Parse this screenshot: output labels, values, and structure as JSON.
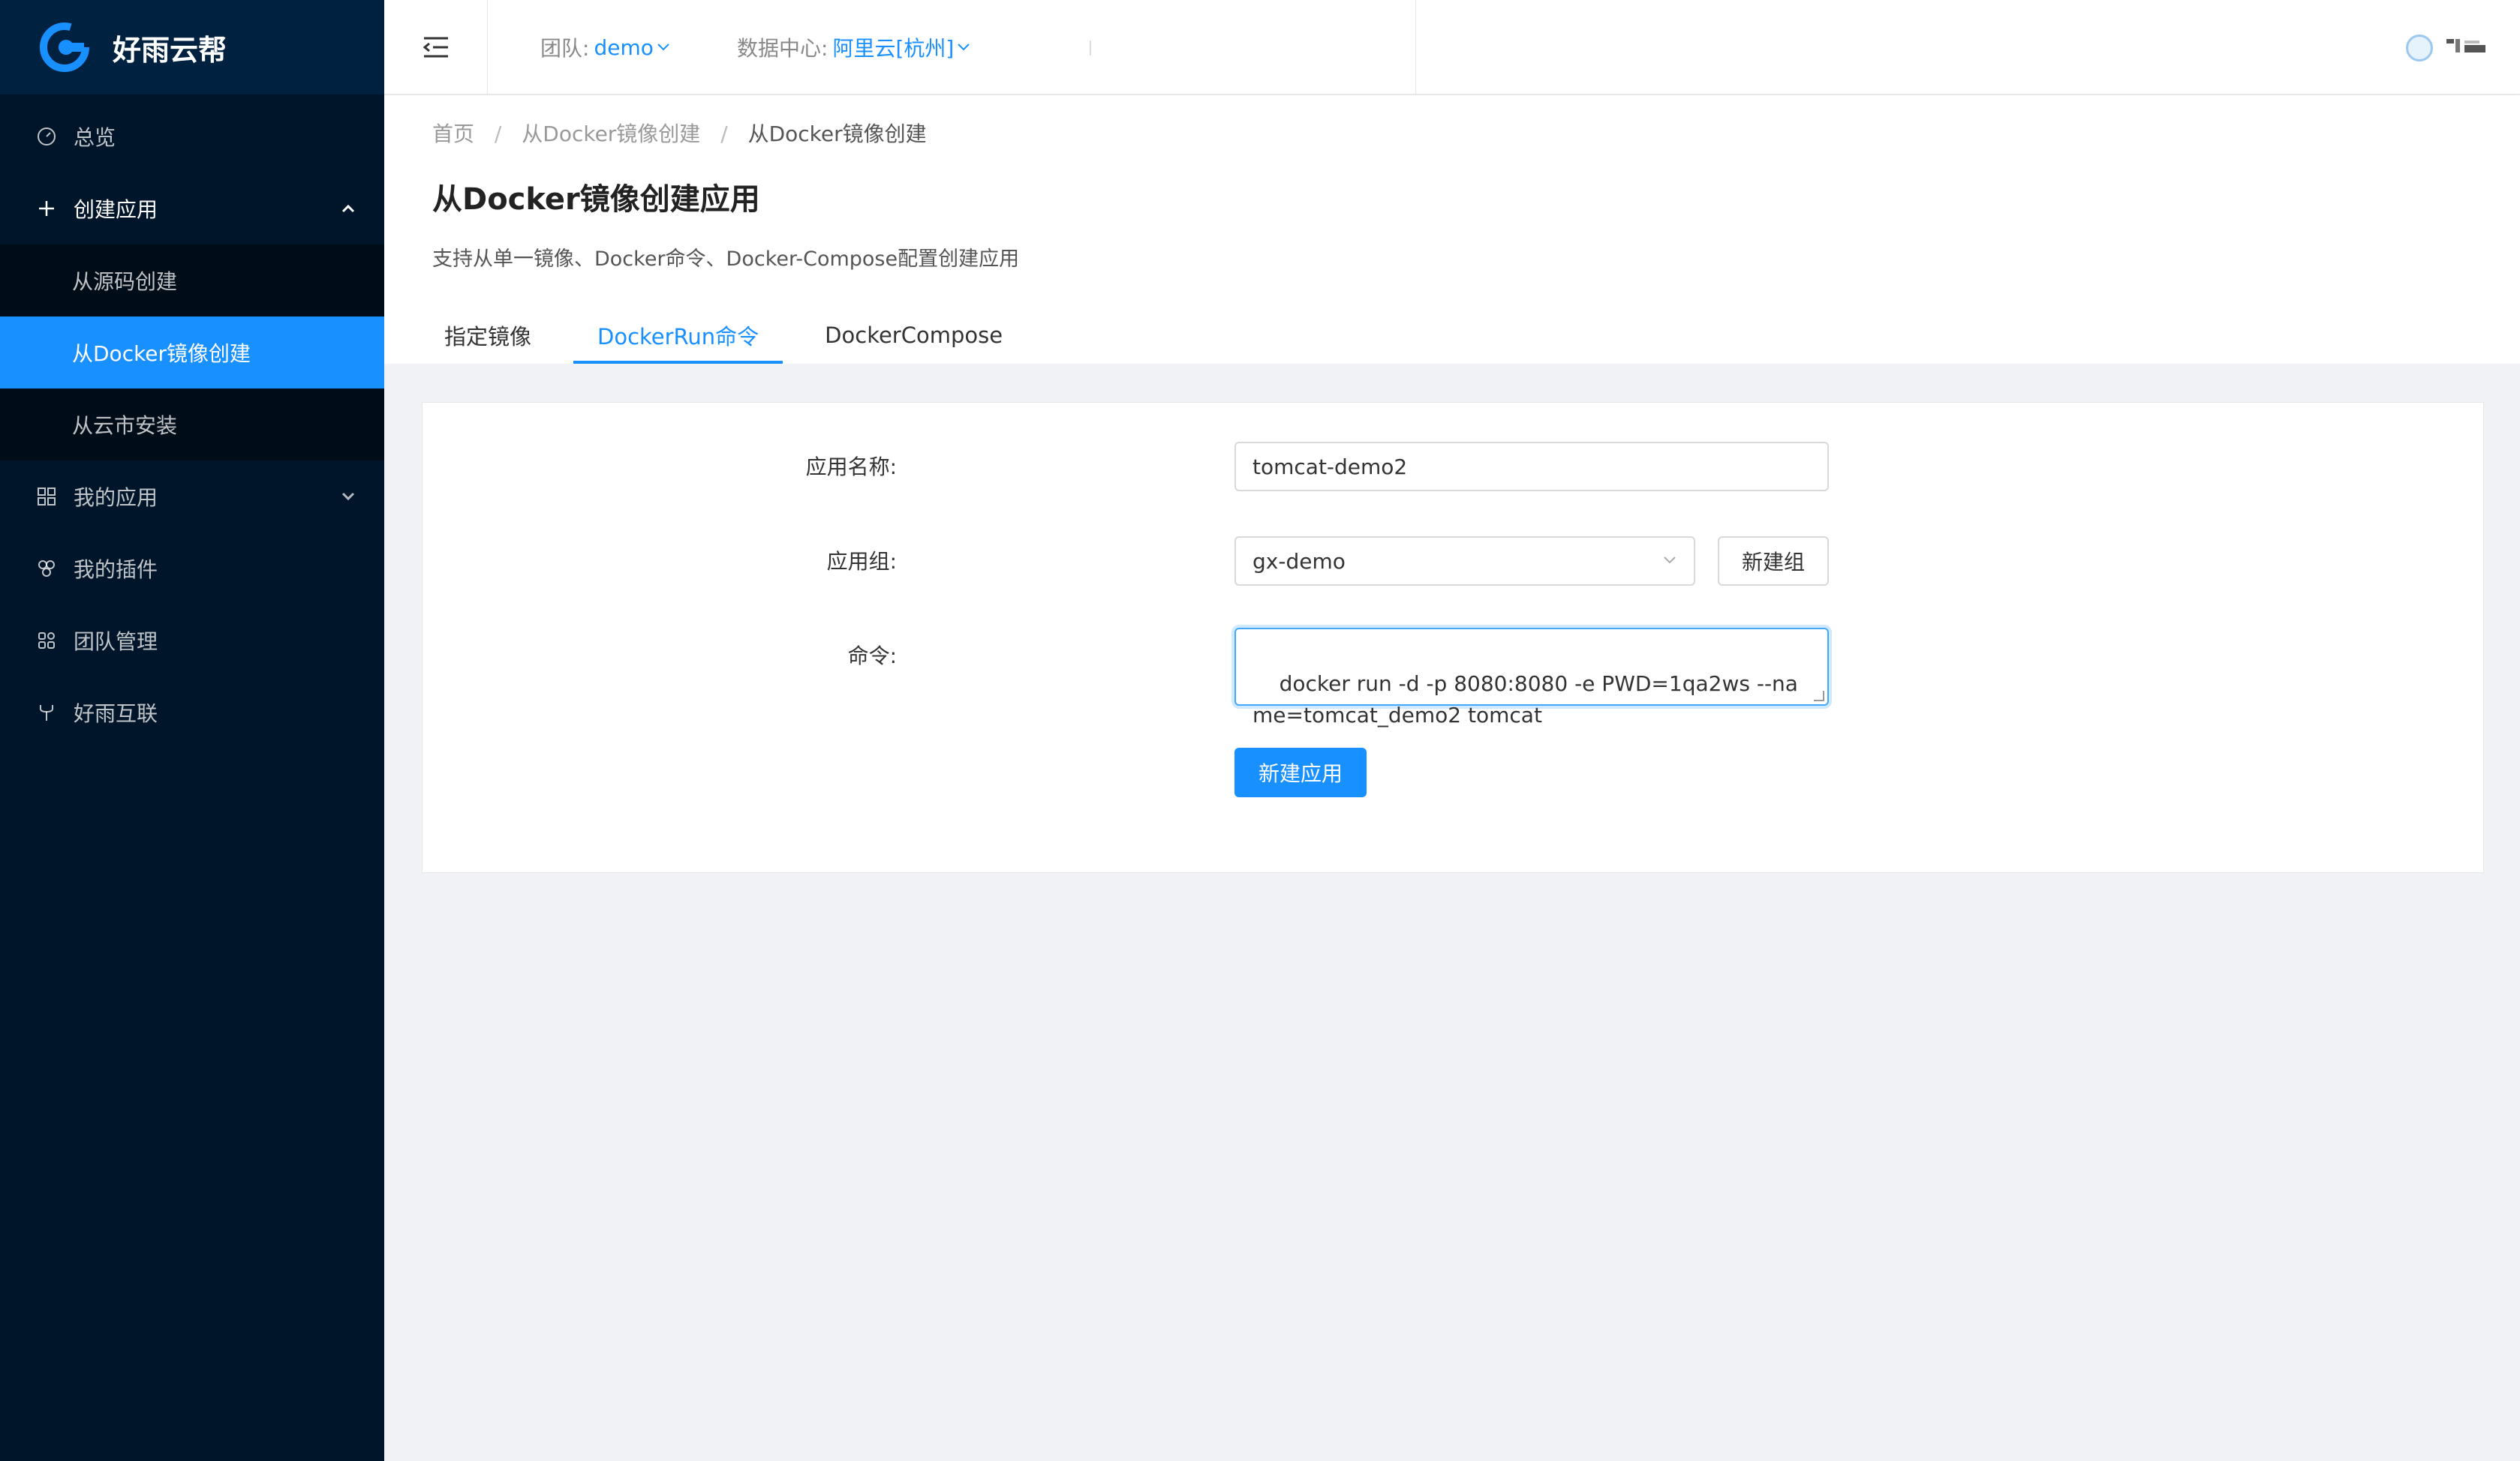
{
  "brand": {
    "name": "好雨云帮"
  },
  "sidebar": {
    "items": [
      {
        "label": "总览",
        "icon": "dashboard-icon"
      },
      {
        "label": "创建应用",
        "icon": "plus-icon",
        "open": true,
        "children": [
          {
            "label": "从源码创建"
          },
          {
            "label": "从Docker镜像创建",
            "selected": true
          },
          {
            "label": "从云市安装"
          }
        ]
      },
      {
        "label": "我的应用",
        "icon": "appstore-icon"
      },
      {
        "label": "我的插件",
        "icon": "plugin-icon"
      },
      {
        "label": "团队管理",
        "icon": "team-icon"
      },
      {
        "label": "好雨互联",
        "icon": "fork-icon"
      }
    ]
  },
  "header": {
    "team_label": "团队:",
    "team_value": "demo",
    "region_label": "数据中心:",
    "region_value": "阿里云[杭州]"
  },
  "breadcrumb": [
    "首页",
    "从Docker镜像创建",
    "从Docker镜像创建"
  ],
  "page": {
    "title": "从Docker镜像创建应用",
    "description": "支持从单一镜像、Docker命令、Docker-Compose配置创建应用"
  },
  "tabs": [
    {
      "label": "指定镜像"
    },
    {
      "label": "DockerRun命令",
      "active": true
    },
    {
      "label": "DockerCompose"
    }
  ],
  "form": {
    "app_name_label": "应用名称:",
    "app_name_value": "tomcat-demo2",
    "group_label": "应用组:",
    "group_value": "gx-demo",
    "new_group_button": "新建组",
    "command_label": "命令:",
    "command_value": "docker run -d -p 8080:8080 -e PWD=1qa2ws --name=tomcat_demo2 tomcat",
    "submit_button": "新建应用"
  },
  "colors": {
    "sidebar_bg": "#001529",
    "primary": "#1890ff",
    "page_bg": "#f0f2f5"
  }
}
